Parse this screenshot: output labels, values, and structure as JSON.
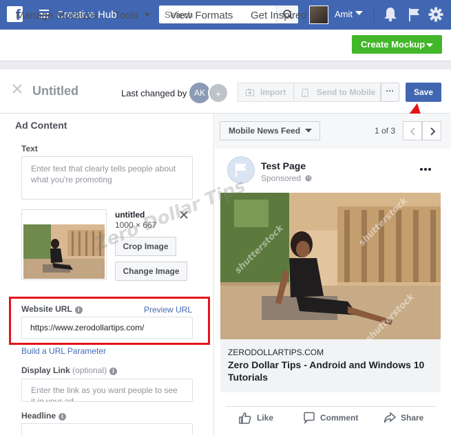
{
  "topbar": {
    "app_title": "Creative Hub",
    "search_placeholder": "Search",
    "user_name": "Amit"
  },
  "nav": {
    "items": [
      "Manage Mockups",
      "Tools",
      "View Formats",
      "Get Inspired"
    ],
    "create_button": "Create Mockup"
  },
  "editor": {
    "title": "Untitled",
    "last_changed_label": "Last changed by",
    "collaborator_initials": "AK",
    "add_collaborator": "+",
    "import_label": "Import",
    "send_to_mobile_label": "Send to Mobile",
    "more_label": "···",
    "save_label": "Save"
  },
  "ad_content": {
    "section_title": "Ad Content",
    "text_label": "Text",
    "text_placeholder": "Enter text that clearly tells people about what you're promoting",
    "image": {
      "name": "untitled",
      "dimensions": "1000 × 667",
      "crop_label": "Crop Image",
      "change_label": "Change Image"
    },
    "website_url_label": "Website URL",
    "preview_url_label": "Preview URL",
    "website_url_value": "https://www.zerodollartips.com/",
    "url_param_link": "Build a URL Parameter",
    "display_link_label": "Display Link",
    "display_link_optional": "(optional)",
    "display_link_placeholder": "Enter the link as you want people to see it in your ad",
    "headline_label": "Headline"
  },
  "preview": {
    "format_dropdown": "Mobile News Feed",
    "page_count": "1 of 3",
    "page_name": "Test Page",
    "sponsored": "Sponsored",
    "domain": "ZERODOLLARTIPS.COM",
    "headline": "Zero Dollar Tips - Android and Windows 10 Tutorials",
    "actions": [
      "Like",
      "Comment",
      "Share"
    ]
  },
  "watermark": {
    "text": "Zero Dollar Tips",
    "stock_mark": "shutterstock"
  },
  "colors": {
    "brand_blue": "#4267b2",
    "create_green": "#42b72a",
    "highlight_red": "#e3131b"
  }
}
